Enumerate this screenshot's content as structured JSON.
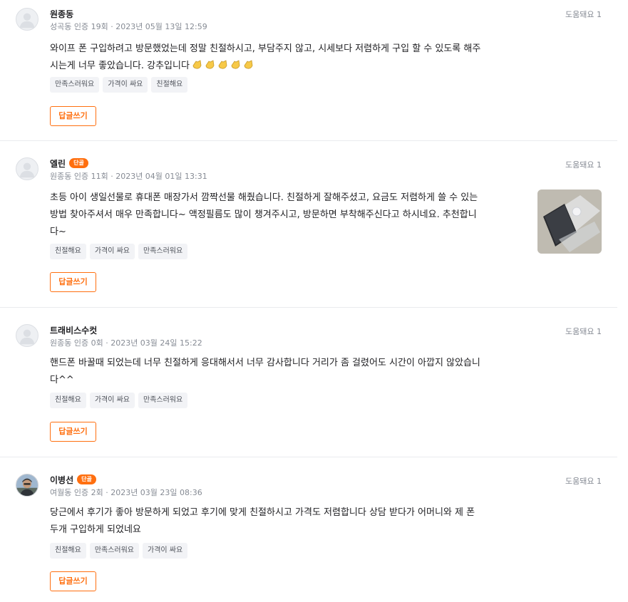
{
  "reviews": [
    {
      "nickname": "원종동",
      "badge": "",
      "meta": "성곡동 인증 19회 · 2023년 05월 13일 12:59",
      "helpful": "도움돼요 1",
      "lines": [
        "와이프 폰 구입하려고 방문했었는데 정말 친절하시고, 부담주지 않고, 시세보다 저렴하게 구입 할 수 있도록 해주",
        "시는게 너무 좋았습니다. 강추입니다"
      ],
      "emoji_count": 5,
      "tags": [
        "만족스러워요",
        "가격이 싸요",
        "친절해요"
      ],
      "reply_label": "답글쓰기"
    },
    {
      "nickname": "엘린",
      "badge": "단골",
      "meta": "원종동 인증 11회 · 2023년 04월 01일 13:31",
      "helpful": "도움돼요 1",
      "lines": [
        "초등 아이 생일선물로 휴대폰 매장가서 깜짝선물 해줬습니다. 친절하게 잘해주셨고, 요금도 저렴하게 쓸 수 있는",
        "방법 찾아주셔서 매우 만족합니다~ 액정필름도 많이 챙겨주시고, 방문하면 부착해주신다고 하시네요. 추천합니",
        "다~"
      ],
      "tags": [
        "친절해요",
        "가격이 싸요",
        "만족스러워요"
      ],
      "reply_label": "답글쓰기",
      "has_photo": true
    },
    {
      "nickname": "트래비스수컷",
      "badge": "",
      "meta": "원종동 인증 0회 · 2023년 03월 24일 15:22",
      "helpful": "도움돼요 1",
      "lines": [
        "핸드폰 바꿀때 되었는데 너무 친절하게 응대해서서 너무 감사합니다 거리가 좀 걸렸어도 시간이 아깝지 않았습니",
        "다^^"
      ],
      "tags": [
        "친절해요",
        "가격이 싸요",
        "만족스러워요"
      ],
      "reply_label": "답글쓰기"
    },
    {
      "nickname": "이병선",
      "badge": "단골",
      "meta": "여월동 인증 2회 · 2023년 03월 23일 08:36",
      "helpful": "도움돼요 1",
      "lines": [
        "당근에서 후기가 좋아 방문하게 되었고 후기에 맞게 친절하시고 가격도 저렴합니다 상담 받다가 어머니와 제 폰",
        "두개 구입하게 되었네요"
      ],
      "tags": [
        "친절해요",
        "만족스러워요",
        "가격이 싸요"
      ],
      "reply_label": "답글쓰기",
      "avatar_photo": true
    }
  ]
}
